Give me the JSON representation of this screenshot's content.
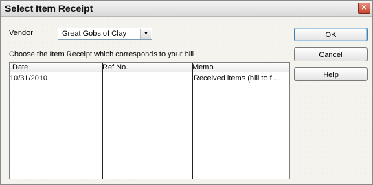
{
  "window": {
    "title": "Select Item Receipt",
    "close_glyph": "✕"
  },
  "vendor": {
    "label_first": "V",
    "label_rest": "endor",
    "selected": "Great Gobs of Clay",
    "dropdown_glyph": "▼"
  },
  "instruction": "Choose the Item Receipt which corresponds to your bill",
  "table": {
    "columns": [
      "Date",
      "Ref No.",
      "Memo"
    ],
    "rows": [
      {
        "date": "10/31/2010",
        "ref_no": "",
        "memo": "Received items (bill to f…"
      }
    ]
  },
  "buttons": {
    "ok": "OK",
    "cancel": "Cancel",
    "help": "Help"
  }
}
